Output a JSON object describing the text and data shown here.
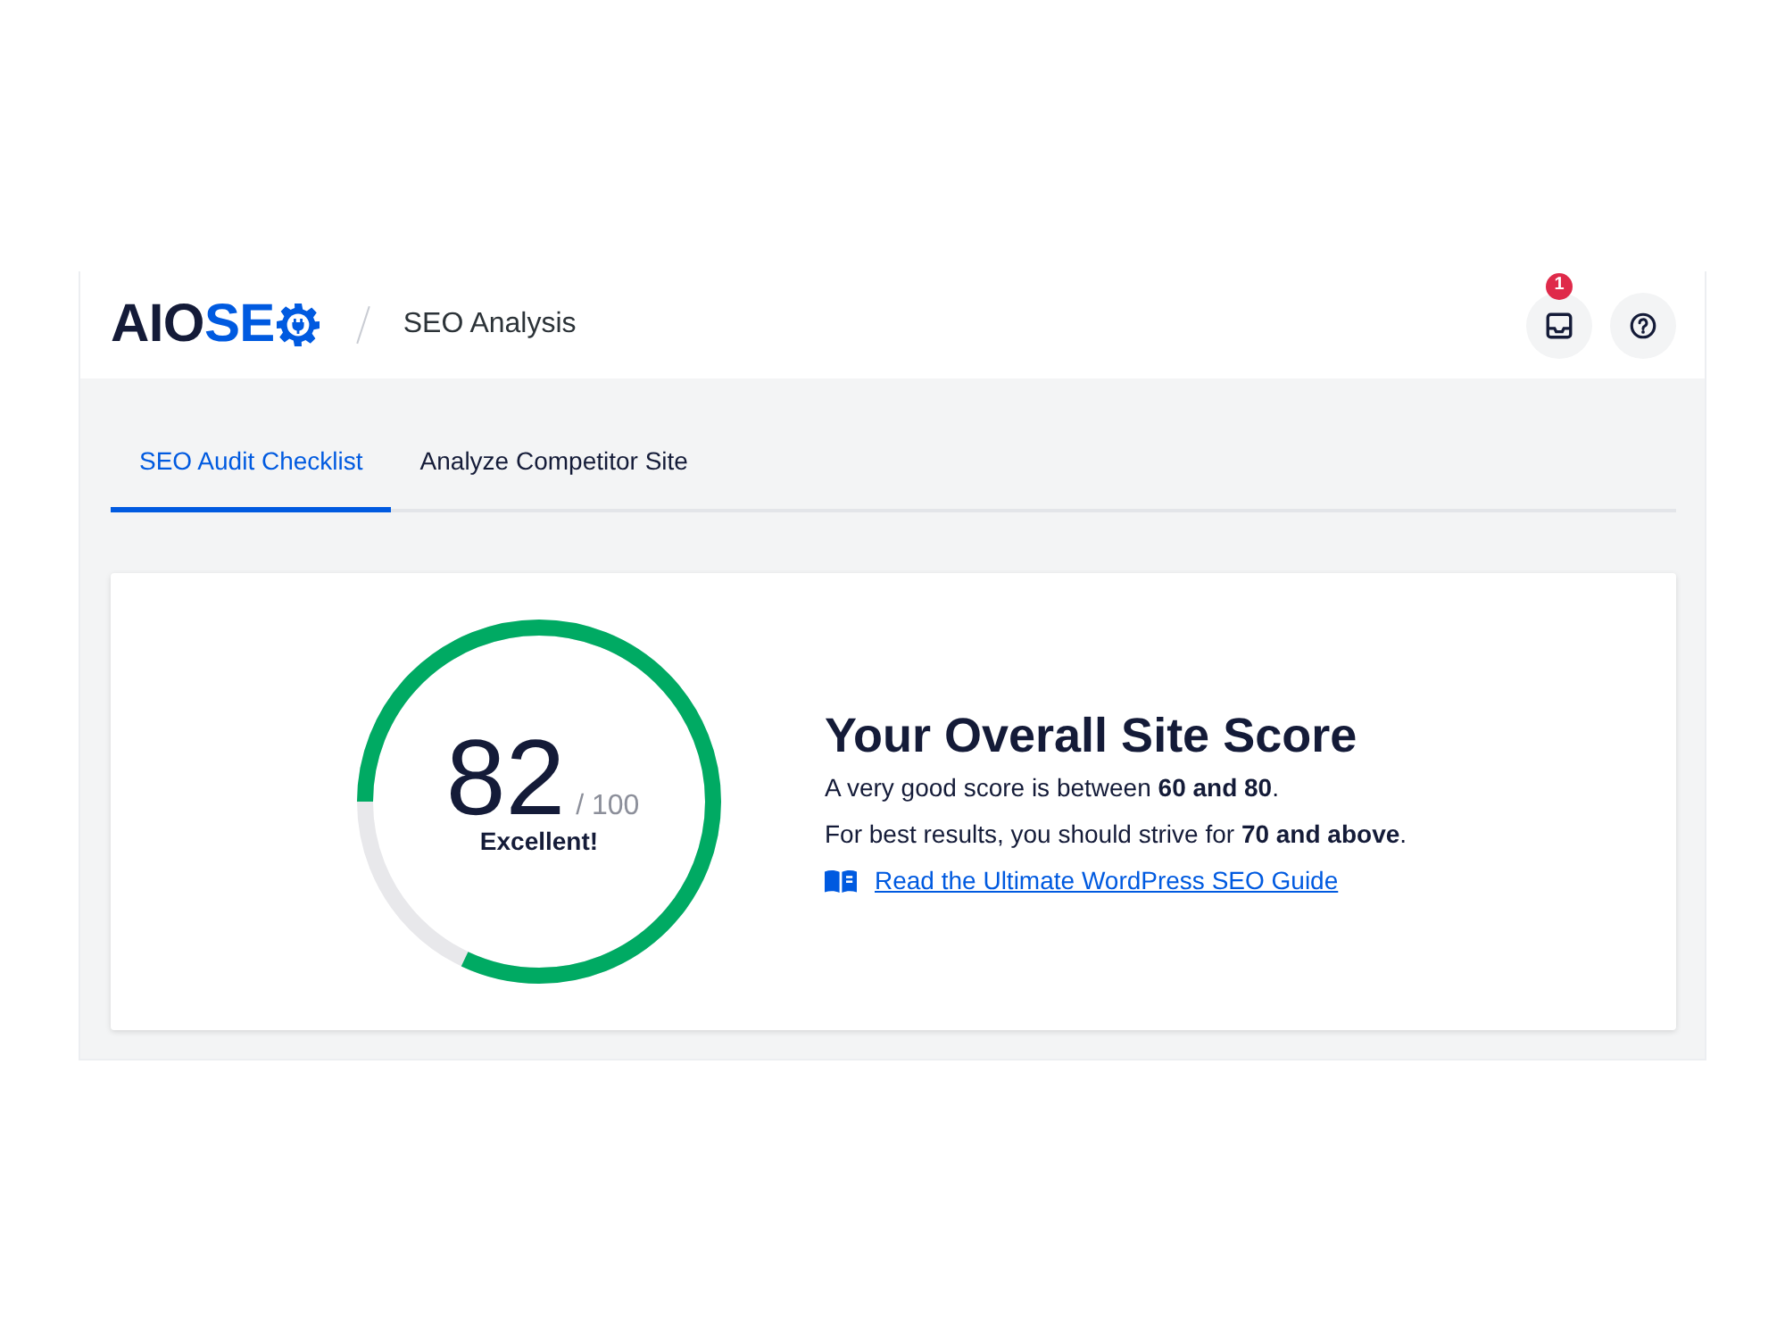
{
  "header": {
    "logo": {
      "text_dark": "AIO",
      "text_accent": "SE"
    },
    "page_title": "SEO Analysis",
    "notifications": {
      "badge": "1"
    }
  },
  "tabs": [
    {
      "label": "SEO Audit Checklist",
      "selected": true
    },
    {
      "label": "Analyze Competitor Site",
      "selected": false
    }
  ],
  "score_card": {
    "score": "82",
    "total": "/ 100",
    "rating": "Excellent!",
    "level": 0.82,
    "title": "Your Overall Site Score",
    "lines": [
      "A very good score is between **60 and 80**.",
      "For best results, you should strive for **70 and above**."
    ],
    "link": "Read the Ultimate WordPress SEO Guide"
  }
}
